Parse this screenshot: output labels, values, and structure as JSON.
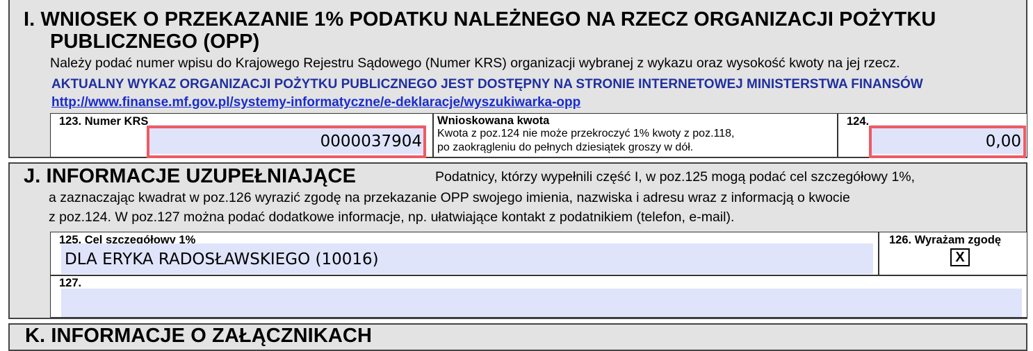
{
  "sectionI": {
    "title_line1": "I. WNIOSEK O PRZEKAZANIE 1% PODATKU NALEŻNEGO NA RZECZ ORGANIZACJI POŻYTKU",
    "title_line2": "PUBLICZNEGO (OPP)",
    "instruction": "Należy podać numer wpisu do Krajowego Rejestru Sądowego (Numer KRS) organizacji wybranej z wykazu oraz wysokość kwoty na jej rzecz.",
    "notice": "AKTUALNY WYKAZ ORGANIZACJI POŻYTKU PUBLICZNEGO JEST DOSTĘPNY NA STRONIE INTERNETOWEJ MINISTERSTWA FINANSÓW",
    "link": "http://www.finanse.mf.gov.pl/systemy-informatyczne/e-deklaracje/wyszukiwarka-opp",
    "krs_label": "123. Numer KRS",
    "krs_value": "0000037904",
    "amount_heading": "Wnioskowana kwota",
    "amount_note1": "Kwota z poz.124 nie może przekroczyć 1% kwoty z poz.118,",
    "amount_note2": "po zaokrągleniu do pełnych dziesiątek groszy w dół.",
    "amount_label": "124.",
    "amount_value": "0,00"
  },
  "sectionJ": {
    "title": "J. INFORMACJE UZUPEŁNIAJĄCE",
    "text1": "Podatnicy, którzy wypełnili część I, w poz.125 mogą podać cel szczegółowy 1%,",
    "text2": "a zaznaczając kwadrat w poz.126 wyrazić zgodę na przekazanie OPP swojego imienia, nazwiska i adresu wraz z informacją o kwocie",
    "text3": "z poz.124. W poz.127 można podać dodatkowe informacje, np. ułatwiające kontakt z podatnikiem (telefon, e-mail).",
    "goal_label": "125. Cel szczegółowy 1%",
    "goal_value": "DLA ERYKA RADOSŁAWSKIEGO (10016)",
    "consent_label": "126. Wyrażam zgodę",
    "consent_mark": "X",
    "extra_label": "127.",
    "extra_value": ""
  },
  "sectionK": {
    "title": "K. INFORMACJE O ZAŁĄCZNIKACH"
  }
}
